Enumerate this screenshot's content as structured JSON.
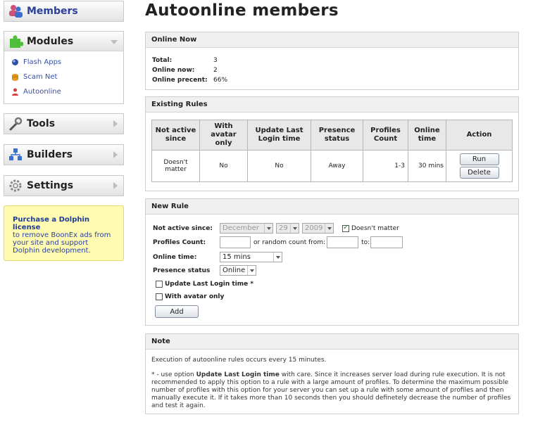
{
  "sidebar": {
    "members": "Members",
    "modules": "Modules",
    "module_items": [
      {
        "label": "Flash Apps",
        "icon": "flash-apps-icon"
      },
      {
        "label": "Scam Net",
        "icon": "scam-net-icon"
      },
      {
        "label": "Autoonline",
        "icon": "autoonline-icon"
      }
    ],
    "tools": "Tools",
    "builders": "Builders",
    "settings": "Settings",
    "promo_link": "Purchase a Dolphin license",
    "promo_text": "to remove BoonEx ads from your site and support Dolphin development."
  },
  "page": {
    "title": "Autoonline members"
  },
  "online_now": {
    "header": "Online Now",
    "total_label": "Total:",
    "total_value": "3",
    "online_label": "Online now:",
    "online_value": "2",
    "percent_label": "Online precent:",
    "percent_value": "66%"
  },
  "existing_rules": {
    "header": "Existing Rules",
    "columns": [
      "Not active since",
      "With avatar only",
      "Update Last Login time",
      "Presence status",
      "Profiles Count",
      "Online time",
      "Action"
    ],
    "rows": [
      {
        "not_active": "Doesn't matter",
        "avatar": "No",
        "update_login": "No",
        "presence": "Away",
        "count": "1-3",
        "online_time": "30 mins",
        "run": "Run",
        "delete": "Delete"
      }
    ]
  },
  "new_rule": {
    "header": "New Rule",
    "not_active_label": "Not active since:",
    "month": "December",
    "day": "29",
    "year": "2009",
    "doesnt_matter": "Doesn't matter",
    "profiles_label": "Profiles Count:",
    "random_label": "or random count from:",
    "to_label": "to:",
    "online_time_label": "Online time:",
    "online_time_value": "15 mins",
    "presence_label": "Presence status",
    "presence_value": "Online",
    "update_login_label": "Update Last Login time *",
    "avatar_label": "With avatar only",
    "add": "Add"
  },
  "note": {
    "header": "Note",
    "line1": "Execution of autoonline rules occurs every 15 minutes.",
    "p2_prefix": "* - use option ",
    "p2_bold": "Update Last Login time",
    "p2_rest": " with care. Since it increases server load during rule execution. It is not recommended to apply this option to a rule with a large amount of profiles. To determine the maximum possible number of profiles with this option for your server you can set up a rule with some amount of profiles and then manually execute it. If it takes more than 10 seconds then you should definetely decrease the number of profiles and test it again."
  }
}
